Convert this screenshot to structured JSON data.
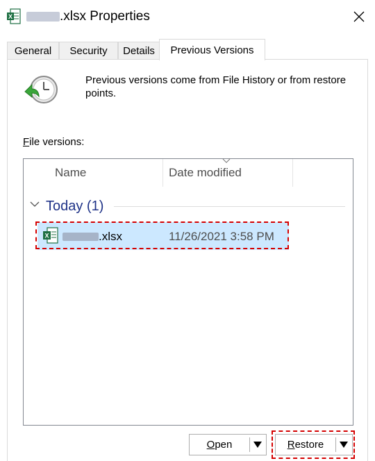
{
  "window": {
    "title_suffix": ".xlsx Properties",
    "close_glyph": "✕"
  },
  "tabs": [
    {
      "label": "General"
    },
    {
      "label": "Security"
    },
    {
      "label": "Details"
    },
    {
      "label": "Previous Versions",
      "active": true
    }
  ],
  "panel": {
    "description": "Previous versions come from File History or from restore points.",
    "file_versions_label_first": "F",
    "file_versions_label_rest": "ile versions:"
  },
  "list": {
    "columns": [
      "Name",
      "Date modified"
    ],
    "group": {
      "label": "Today (1)"
    },
    "rows": [
      {
        "name_suffix": ".xlsx",
        "date_modified": "11/26/2021 3:58 PM"
      }
    ]
  },
  "buttons": {
    "open_first": "O",
    "open_rest": "pen",
    "restore_first": "R",
    "restore_rest": "estore"
  },
  "colors": {
    "selection": "#cce8ff",
    "highlight_outline": "#d40000",
    "group_text": "#1e3287",
    "excel_green": "#1d6f42"
  },
  "icons": {
    "title": "excel-file-icon",
    "close": "close-icon",
    "history": "clock-restore-icon",
    "file": "excel-file-icon"
  }
}
